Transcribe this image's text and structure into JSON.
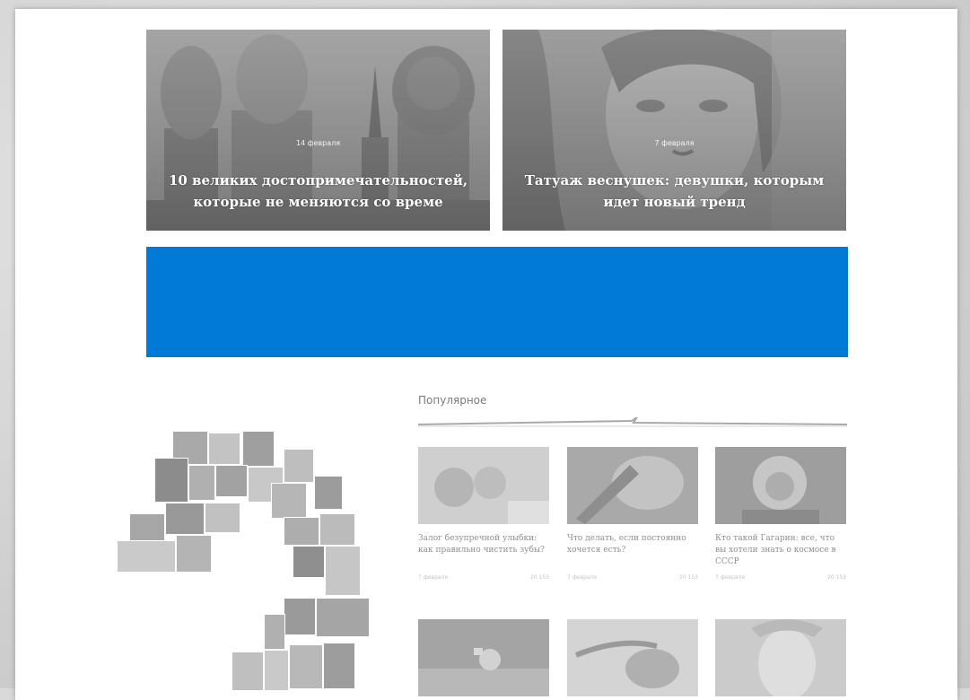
{
  "hero": [
    {
      "date": "14 февраля",
      "title_line1": "10 великих достопримечательностей,",
      "title_line2": "которые не меняются со време"
    },
    {
      "date": "7 февраля",
      "title_line1": "Татуаж веснушек: девушки, которым",
      "title_line2": "идет новый тренд"
    }
  ],
  "popular": {
    "heading": "Популярное",
    "cards": [
      {
        "title": "Залог безупречной улыбки: как правильно чистить зубы?",
        "date": "7 февраля",
        "views": "20 153",
        "icon": "child-photo"
      },
      {
        "title": "Что делать, если постоянно хочется есть?",
        "date": "7 февраля",
        "views": "20 153",
        "icon": "food-photo"
      },
      {
        "title": "Кто такой Гагарин: все, что вы хотели знать о космосе в СССР",
        "date": "7 февраля",
        "views": "20 153",
        "icon": "cosmonaut-photo"
      },
      {
        "title": "",
        "date": "",
        "views": "",
        "icon": "astronaut-photo"
      },
      {
        "title": "",
        "date": "",
        "views": "",
        "icon": "blood-pressure-photo"
      },
      {
        "title": "",
        "date": "",
        "views": "",
        "icon": "face-mask-photo"
      }
    ]
  },
  "colors": {
    "banner": "#0079d7",
    "background": "#ffffff",
    "text_muted": "#8f8f8f"
  }
}
